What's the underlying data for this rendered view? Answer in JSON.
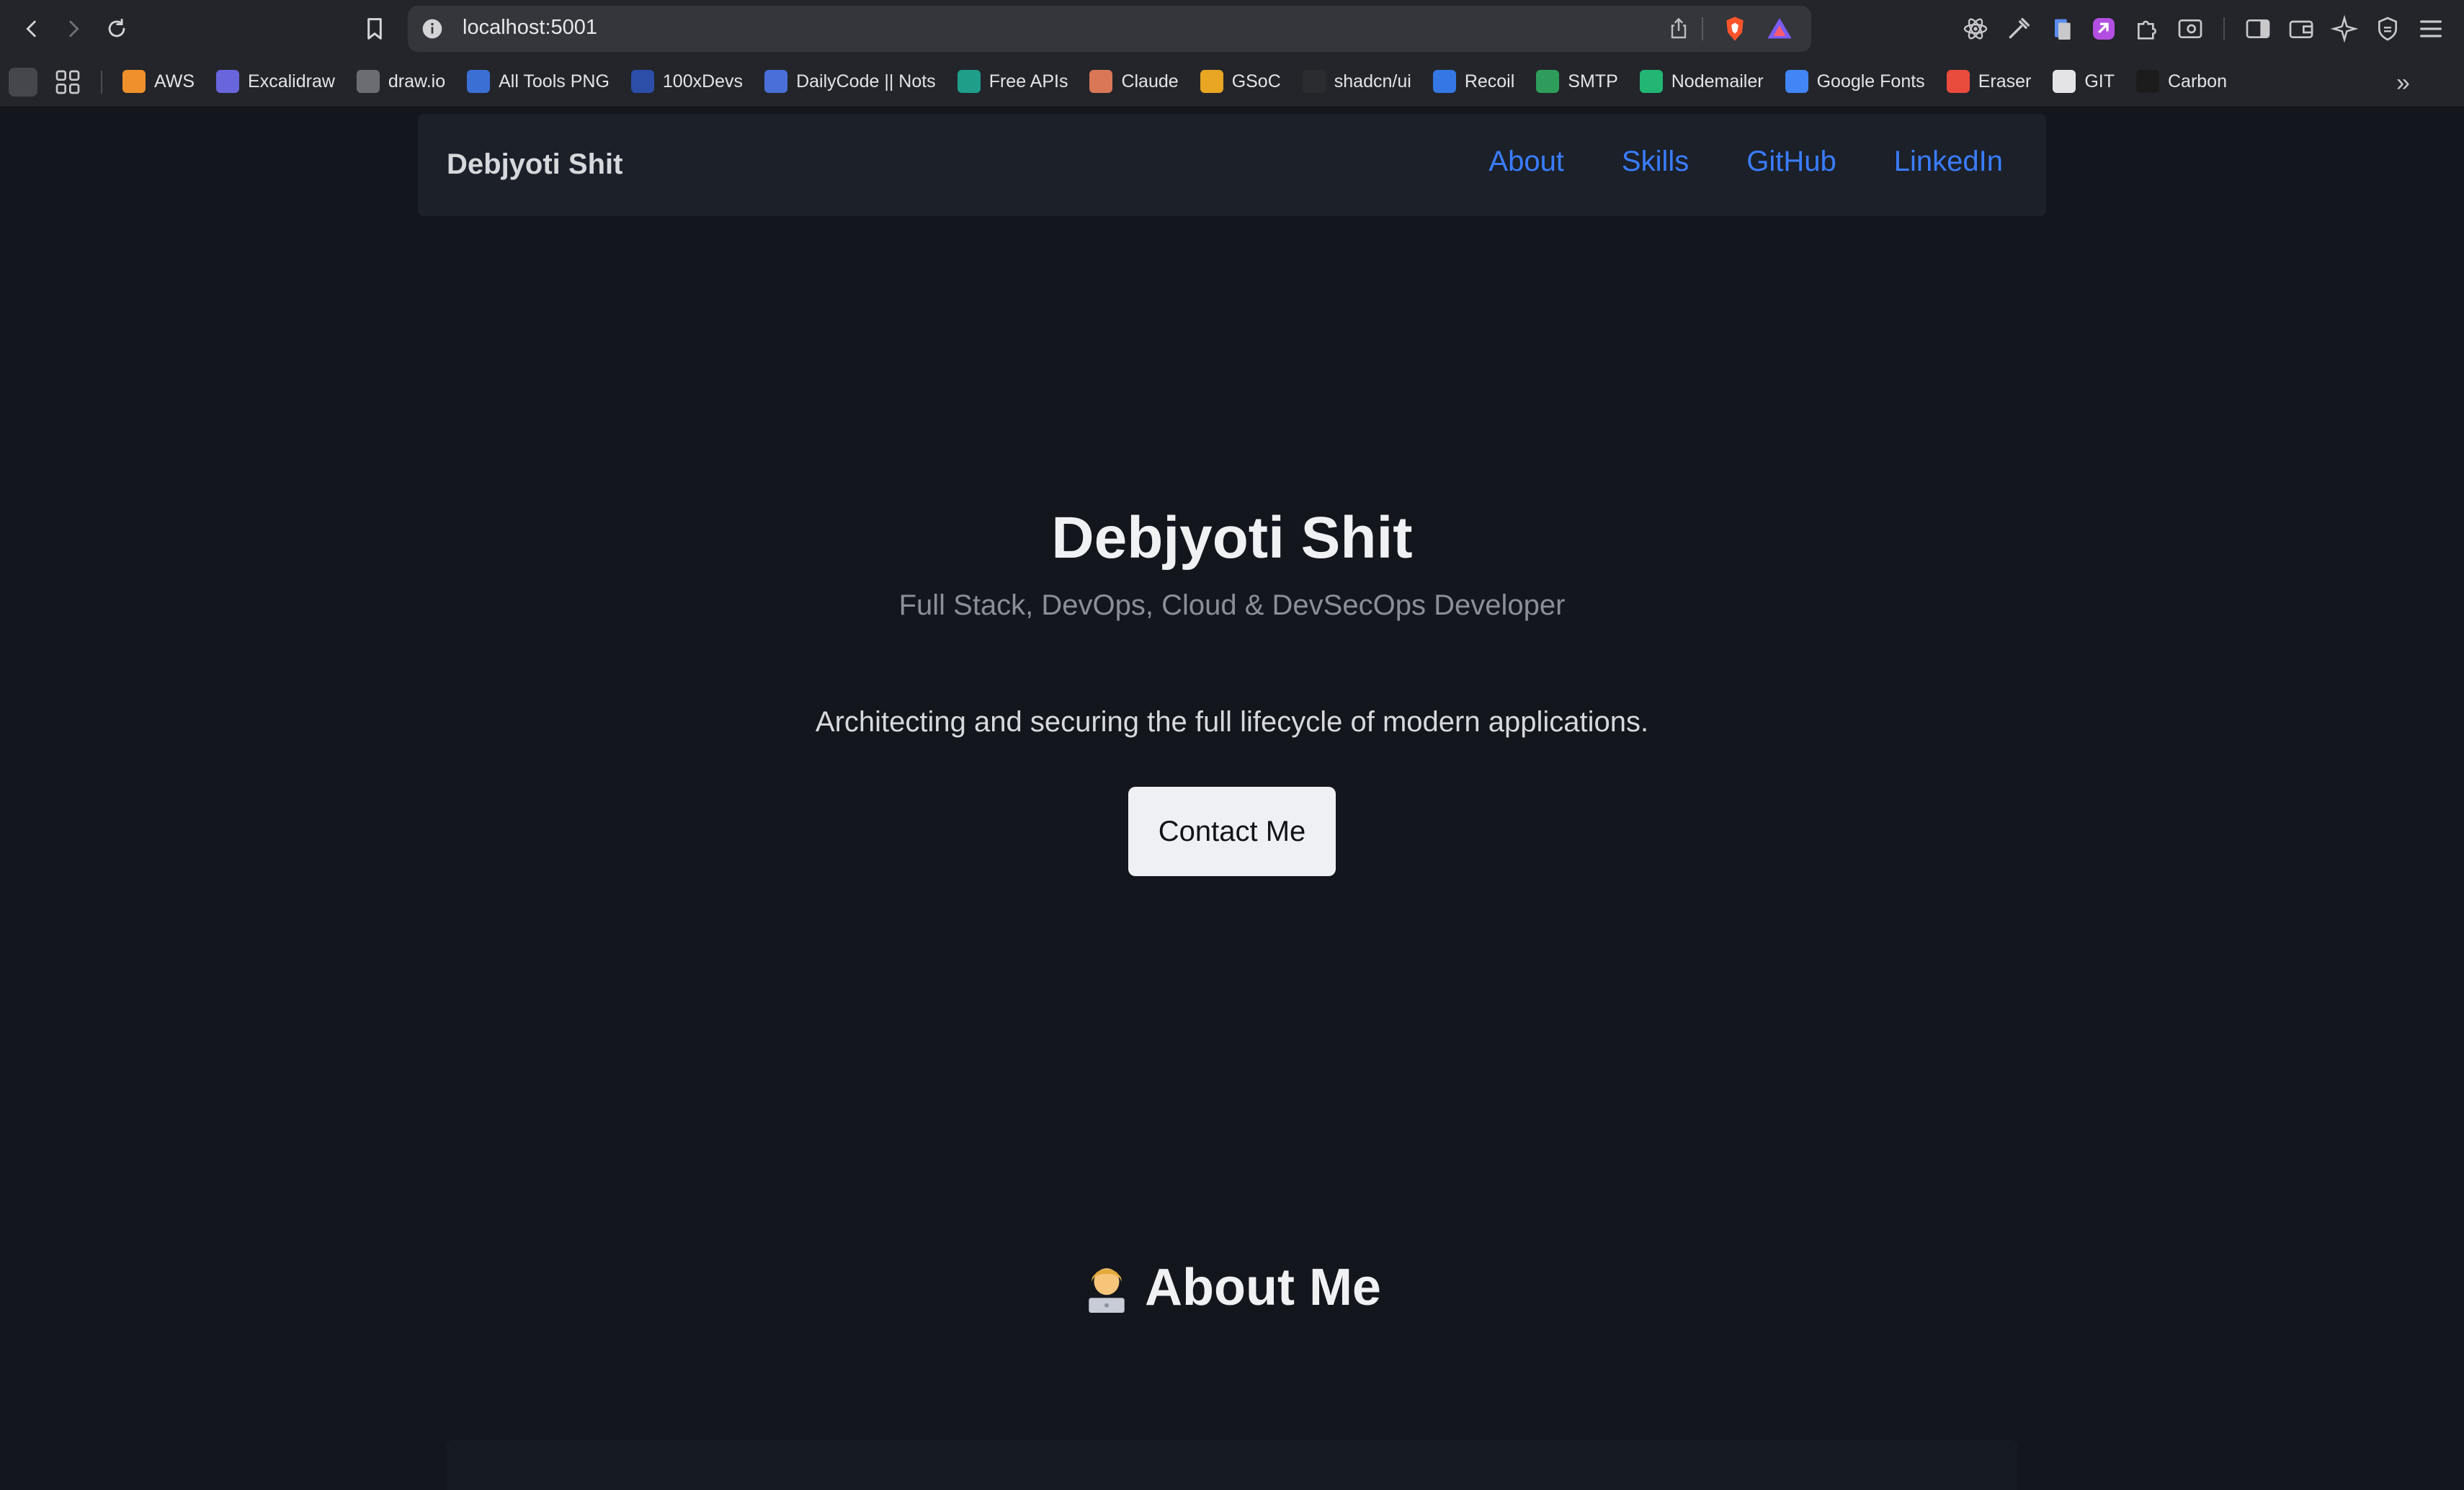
{
  "browser": {
    "url": "localhost:5001",
    "bookmarks": [
      {
        "label": "AWS",
        "icon": "aws-icon",
        "color": "#f0902c"
      },
      {
        "label": "Excalidraw",
        "icon": "excalidraw-icon",
        "color": "#6965db"
      },
      {
        "label": "draw.io",
        "icon": "drawio-icon",
        "color": "#6b6d72"
      },
      {
        "label": "All Tools PNG",
        "icon": "alltools-icon",
        "color": "#3b6fd4"
      },
      {
        "label": "100xDevs",
        "icon": "100xdevs-icon",
        "color": "#2c4da8"
      },
      {
        "label": "DailyCode || Nots",
        "icon": "dailycode-icon",
        "color": "#4a6fd8"
      },
      {
        "label": "Free APIs",
        "icon": "freeapis-icon",
        "color": "#1f9e8a"
      },
      {
        "label": "Claude",
        "icon": "claude-icon",
        "color": "#d97757"
      },
      {
        "label": "GSoC",
        "icon": "gsoc-icon",
        "color": "#e8a623"
      },
      {
        "label": "shadcn/ui",
        "icon": "shadcn-icon",
        "color": "#2a2c30"
      },
      {
        "label": "Recoil",
        "icon": "recoil-icon",
        "color": "#3578e5"
      },
      {
        "label": "SMTP",
        "icon": "smtp-icon",
        "color": "#2e9d5b"
      },
      {
        "label": "Nodemailer",
        "icon": "nodemailer-icon",
        "color": "#22b573"
      },
      {
        "label": "Google Fonts",
        "icon": "googlefonts-icon",
        "color": "#4285f4"
      },
      {
        "label": "Eraser",
        "icon": "eraser-icon",
        "color": "#e94b3c"
      },
      {
        "label": "GIT",
        "icon": "github-icon",
        "color": "#e4e4e6"
      },
      {
        "label": "Carbon",
        "icon": "carbon-icon",
        "color": "#1c1c1c"
      }
    ]
  },
  "navbar": {
    "brand": "Debjyoti Shit",
    "links": [
      "About",
      "Skills",
      "GitHub",
      "LinkedIn"
    ]
  },
  "hero": {
    "name": "Debjyoti Shit",
    "subtitle": "Full Stack, DevOps, Cloud & DevSecOps Developer",
    "tagline": "Architecting and securing the full lifecycle of modern applications.",
    "cta": "Contact Me"
  },
  "about": {
    "title": "About Me",
    "emoji": "technologist-emoji"
  },
  "colors": {
    "page_bg": "#13171d",
    "nav_bg": "#1b2029",
    "link": "#3a7dff",
    "chrome_bg": "#23252a"
  }
}
